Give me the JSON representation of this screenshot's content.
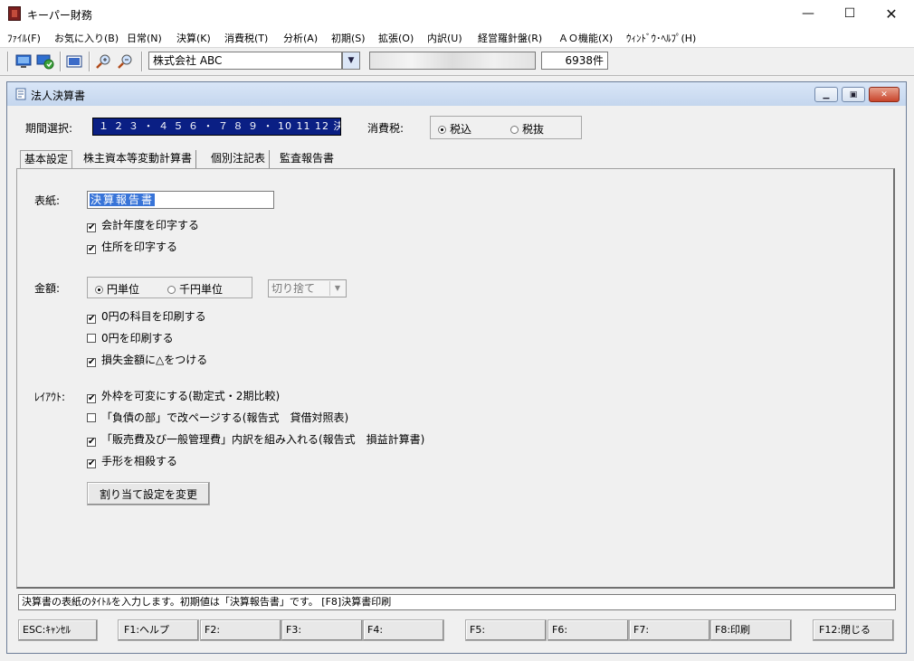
{
  "app": {
    "title": "キーパー財務"
  },
  "menu": [
    "ﾌｧｲﾙ(F)",
    "お気に入り(B)",
    "日常(N)",
    "決算(K)",
    "消費税(T)",
    "分析(A)",
    "初期(S)",
    "拡張(O)",
    "内訳(U)",
    "経営羅針盤(R)",
    "ＡＯ機能(X)",
    "ｳｨﾝﾄﾞｳ･ﾍﾙﾌﾟ(H)"
  ],
  "toolbar": {
    "company": "株式会社 ABC",
    "count": "6938件"
  },
  "window": {
    "title": "法人決算書"
  },
  "period": {
    "label": "期間選択:",
    "value": "１ ２ ３ ・ ４ ５ ６ ・ ７ ８ ９ ・ 10 11 12 決"
  },
  "tax": {
    "label": "消費税:",
    "options": [
      "税込",
      "税抜"
    ]
  },
  "tabs": [
    "基本設定",
    "株主資本等変動計算書",
    "個別注記表",
    "監査報告書"
  ],
  "cover": {
    "label": "表紙:",
    "value": "決算報告書",
    "checks": [
      "会計年度を印字する",
      "住所を印字する"
    ]
  },
  "amount": {
    "label": "金額:",
    "options": [
      "円単位",
      "千円単位"
    ],
    "rounding": "切り捨て",
    "checks": [
      {
        "text": "0円の科目を印刷する",
        "checked": "✔"
      },
      {
        "text": "0円を印刷する",
        "checked": ""
      },
      {
        "text": "損失金額に△をつける",
        "checked": "✔"
      }
    ]
  },
  "layout": {
    "label": "ﾚｲｱｳﾄ:",
    "checks": [
      {
        "text": "外枠を可変にする(勘定式・2期比較)",
        "checked": "✔"
      },
      {
        "text": "「負債の部」で改ページする(報告式　貸借対照表)",
        "checked": ""
      },
      {
        "text": "「販売費及び一般管理費」内訳を組み入れる(報告式　損益計算書)",
        "checked": "✔"
      },
      {
        "text": "手形を相殺する",
        "checked": "✔"
      }
    ],
    "button": "割り当て設定を変更"
  },
  "status": "決算書の表紙のﾀｲﾄﾙを入力します。初期値は「決算報告書」です。 [F8]決算書印刷",
  "fkeys": [
    "ESC:ｷｬﾝｾﾙ",
    "F1:ヘルプ",
    "F2:",
    "F3:",
    "F4:",
    "F5:",
    "F6:",
    "F7:",
    "F8:印刷",
    "F12:閉じる"
  ]
}
